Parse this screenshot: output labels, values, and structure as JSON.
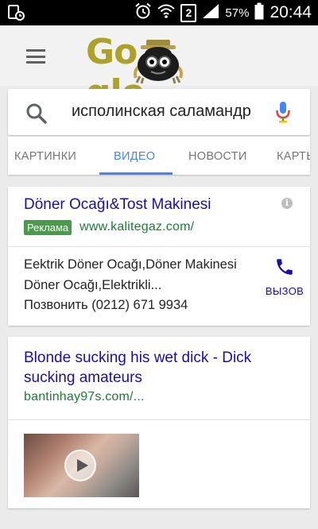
{
  "status_bar": {
    "battery_percent": "57%",
    "time": "20:44",
    "sim_number": "2",
    "icons": [
      "screenshot-icon",
      "alarm-icon",
      "wifi-icon",
      "sim-icon",
      "signal-icon",
      "battery-icon"
    ]
  },
  "header": {
    "logo_text_left": "Go",
    "logo_text_right": "gle",
    "menu_icon": "hamburger-icon"
  },
  "search": {
    "query": "исполинская саламандр",
    "search_icon": "search-icon",
    "mic_icon": "mic-icon"
  },
  "tabs": [
    {
      "label": "КАРТИНКИ",
      "active": false
    },
    {
      "label": "ВИДЕО",
      "active": true
    },
    {
      "label": "НОВОСТИ",
      "active": false
    },
    {
      "label": "КАРТЫ",
      "active": false
    }
  ],
  "ad": {
    "title": "Döner Ocağı&Tost Makinesi",
    "badge": "Реклама",
    "url": "www.kalitegaz.com/",
    "desc_line1": "Eektrik Döner Ocağı,Döner Makinesi",
    "desc_line2": "Döner Ocağı,Elektrikli...",
    "desc_line3": "Позвонить (0212) 671 9934",
    "call_label": "ВЫЗОВ",
    "call_icon": "phone-icon",
    "info_icon": "info-icon"
  },
  "result": {
    "title": "Blonde sucking his wet dick - Dick sucking amateurs",
    "url": "bantinhay97s.com/...",
    "play_icon": "play-icon"
  },
  "colors": {
    "link_blue": "#1a0dab",
    "url_green": "#1e7b34",
    "tab_active": "#4285f4",
    "ad_badge": "#4a9a4c",
    "logo_olive": "#aea12a"
  }
}
